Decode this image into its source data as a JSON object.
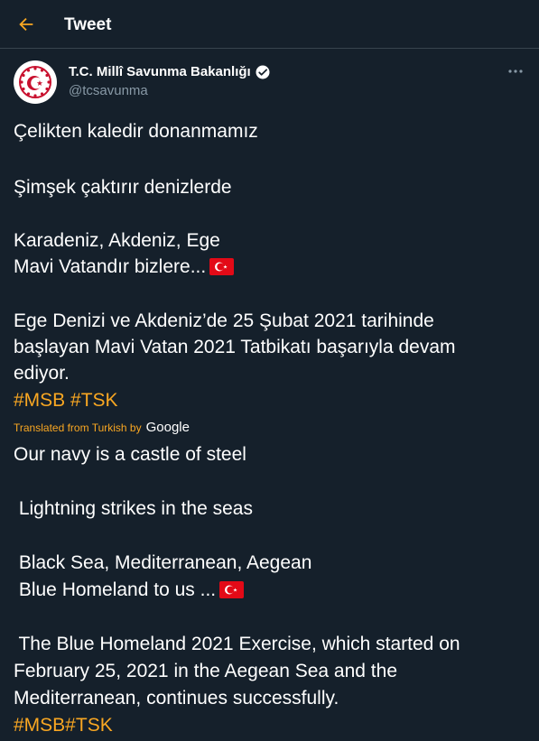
{
  "header": {
    "title": "Tweet",
    "back_icon": "arrow-left-icon",
    "accent_color": "#f9a722"
  },
  "author": {
    "display_name": "T.C. Millî Savunma Bakanlığı",
    "handle": "@tcsavunma",
    "verified_icon": "verified-badge-icon",
    "avatar_icon": "ministry-seal-icon"
  },
  "more_icon": "more-dots-icon",
  "original": {
    "line1": "Çelikten kaledir donanmamız",
    "line2": "Şimşek çaktırır denizlerde",
    "line3": "Karadeniz, Akdeniz, Ege",
    "line4": "Mavi Vatandır bizlere...",
    "line5": "Ege Denizi ve Akdeniz’de 25 Şubat 2021 tarihinde",
    "line6": "başlayan Mavi Vatan 2021 Tatbikatı başarıyla devam",
    "line7": "ediyor.",
    "hashtags": "#MSB #TSK"
  },
  "translation": {
    "label": "Translated from Turkish by",
    "provider": "Google",
    "line1": "Our navy is a castle of steel",
    "line2": " Lightning strikes in the seas",
    "line3": " Black Sea, Mediterranean, Aegean",
    "line4": " Blue Homeland to us ...",
    "line5": " The Blue Homeland 2021 Exercise, which started on",
    "line6": "February 25, 2021 in the Aegean Sea and the",
    "line7": "Mediterranean, continues successfully.",
    "hashtags": "#MSB#TSK"
  },
  "flag_icon": "turkish-flag-icon"
}
